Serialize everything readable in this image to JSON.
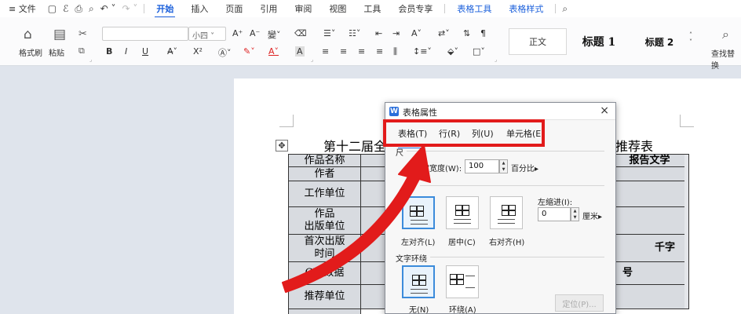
{
  "menubar": {
    "file": "≡ 文件",
    "tabs": [
      "开始",
      "插入",
      "页面",
      "引用",
      "审阅",
      "视图",
      "工具",
      "会员专享",
      "表格工具",
      "表格样式"
    ]
  },
  "ribbon": {
    "format_painter": "格式刷",
    "paste": "粘贴",
    "font_size": "小四",
    "bold": "B",
    "italic": "I",
    "underline": "U",
    "superscript": "X²",
    "style_normal": "正文",
    "style_h1": "标题 1",
    "style_h2": "标题 2",
    "find_replace": "查找替换"
  },
  "document": {
    "title_left": "第十二届全",
    "title_right": "推荐表",
    "rows": [
      "作品名称",
      "作者",
      "工作单位",
      "作品\n出版单位",
      "首次出版\n时间",
      "CIP数据",
      "推荐单位"
    ],
    "right_cells": [
      "报告文学",
      "千字",
      "号"
    ]
  },
  "dialog": {
    "title": "表格属性",
    "close": "×",
    "tabs": [
      "表格(T)",
      "行(R)",
      "列(U)",
      "单元格(E)"
    ],
    "size_label_partial": "尺",
    "width_label": "定宽度(W):",
    "width_value": "100",
    "width_unit": "百分比",
    "indent_label": "左缩进(I):",
    "indent_value": "0",
    "indent_unit": "厘米",
    "align_options": [
      "左对齐(L)",
      "居中(C)",
      "右对齐(H)"
    ],
    "wrap_section": "文字环绕",
    "wrap_options": [
      "无(N)",
      "环绕(A)"
    ],
    "position_button": "定位(P)..."
  },
  "annotation": {
    "highlight_color": "#e21b1b"
  }
}
